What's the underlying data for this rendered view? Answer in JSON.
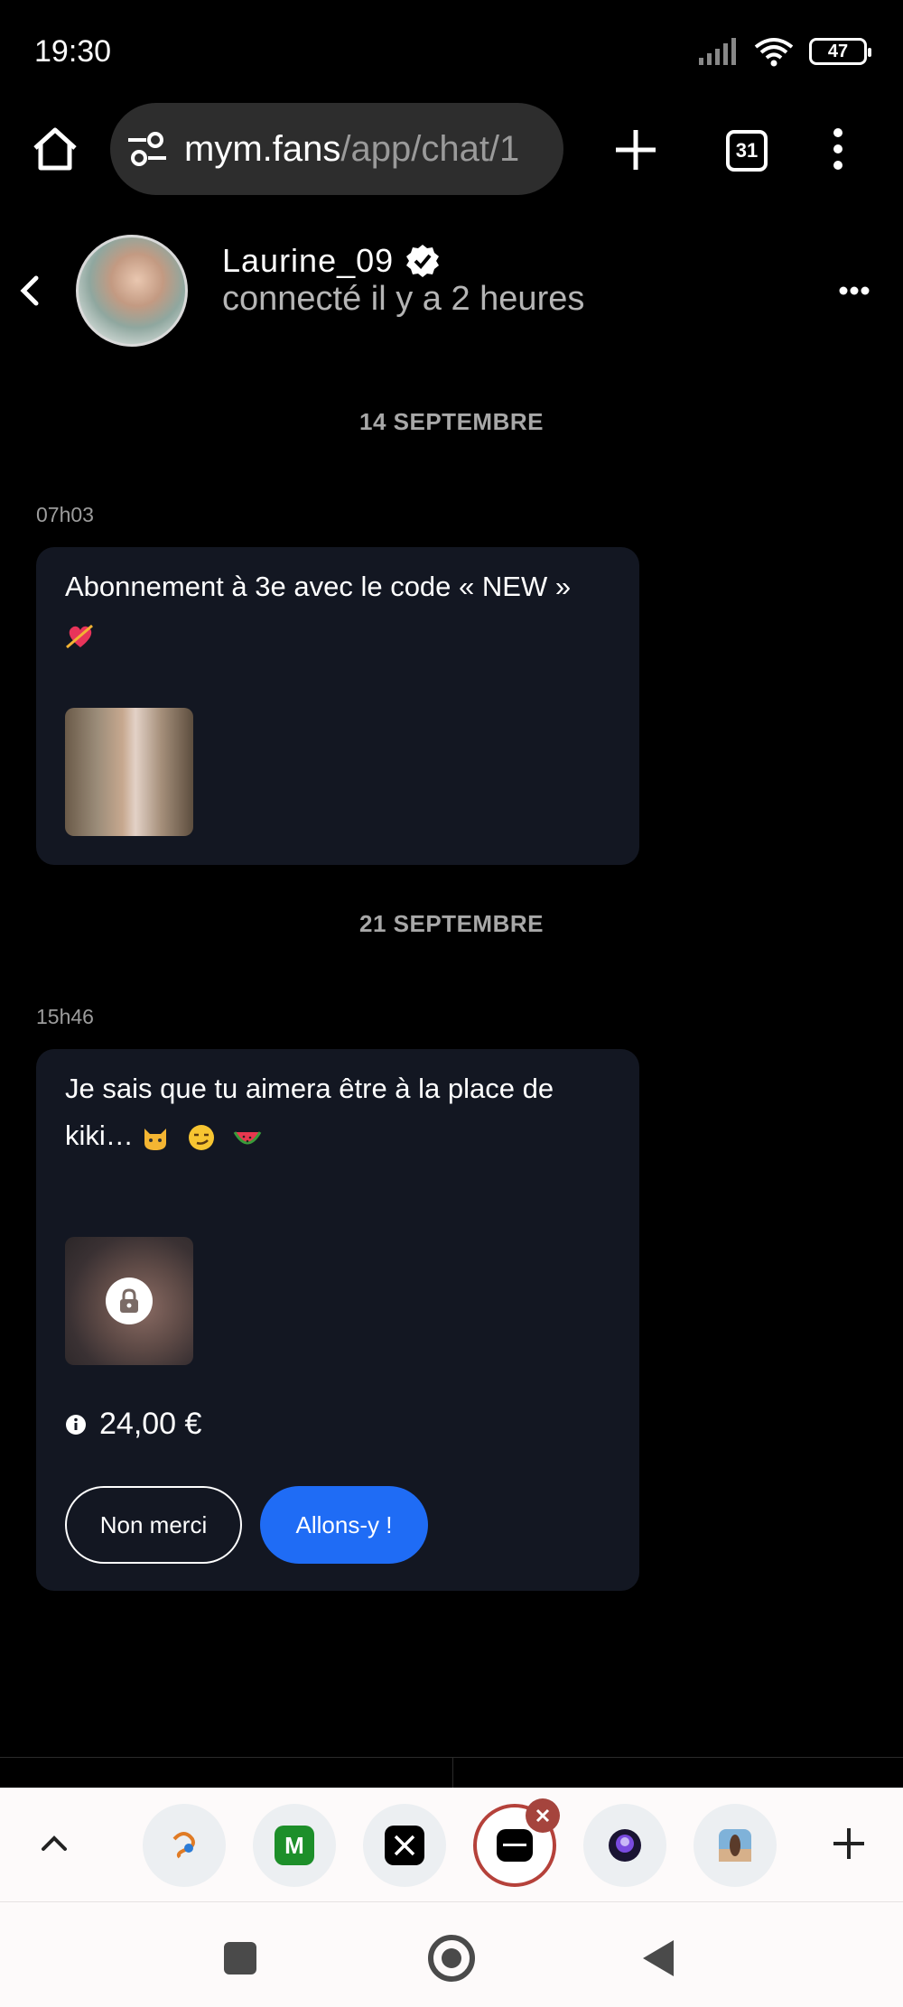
{
  "status_bar": {
    "time": "19:30",
    "battery": "47"
  },
  "browser": {
    "url_host": "mym.fans",
    "url_path": "/app/chat/1",
    "tab_count": "31"
  },
  "chat": {
    "username": "Laurine_09",
    "presence": "connecté il y a 2 heures",
    "sections": [
      {
        "date": "14 SEPTEMBRE",
        "time": "07h03",
        "message": "Abonnement à 3e avec le code « NEW »"
      },
      {
        "date": "21 SEPTEMBRE",
        "time": "15h46",
        "message_line1": "Je sais que tu aimera être à la place de",
        "message_line2": "kiki…",
        "price": "24,00 €",
        "decline_label": "Non merci",
        "accept_label": "Allons-y !"
      }
    ]
  },
  "colors": {
    "background": "#000000",
    "bubble": "#131722",
    "accent_button": "#1f6cf5",
    "active_tab_ring": "#b5413a"
  },
  "tab_strip": {
    "tabs": [
      "tab-1",
      "tab-2-m",
      "tab-3-x",
      "tab-4-mym-active",
      "tab-5",
      "tab-6"
    ]
  }
}
